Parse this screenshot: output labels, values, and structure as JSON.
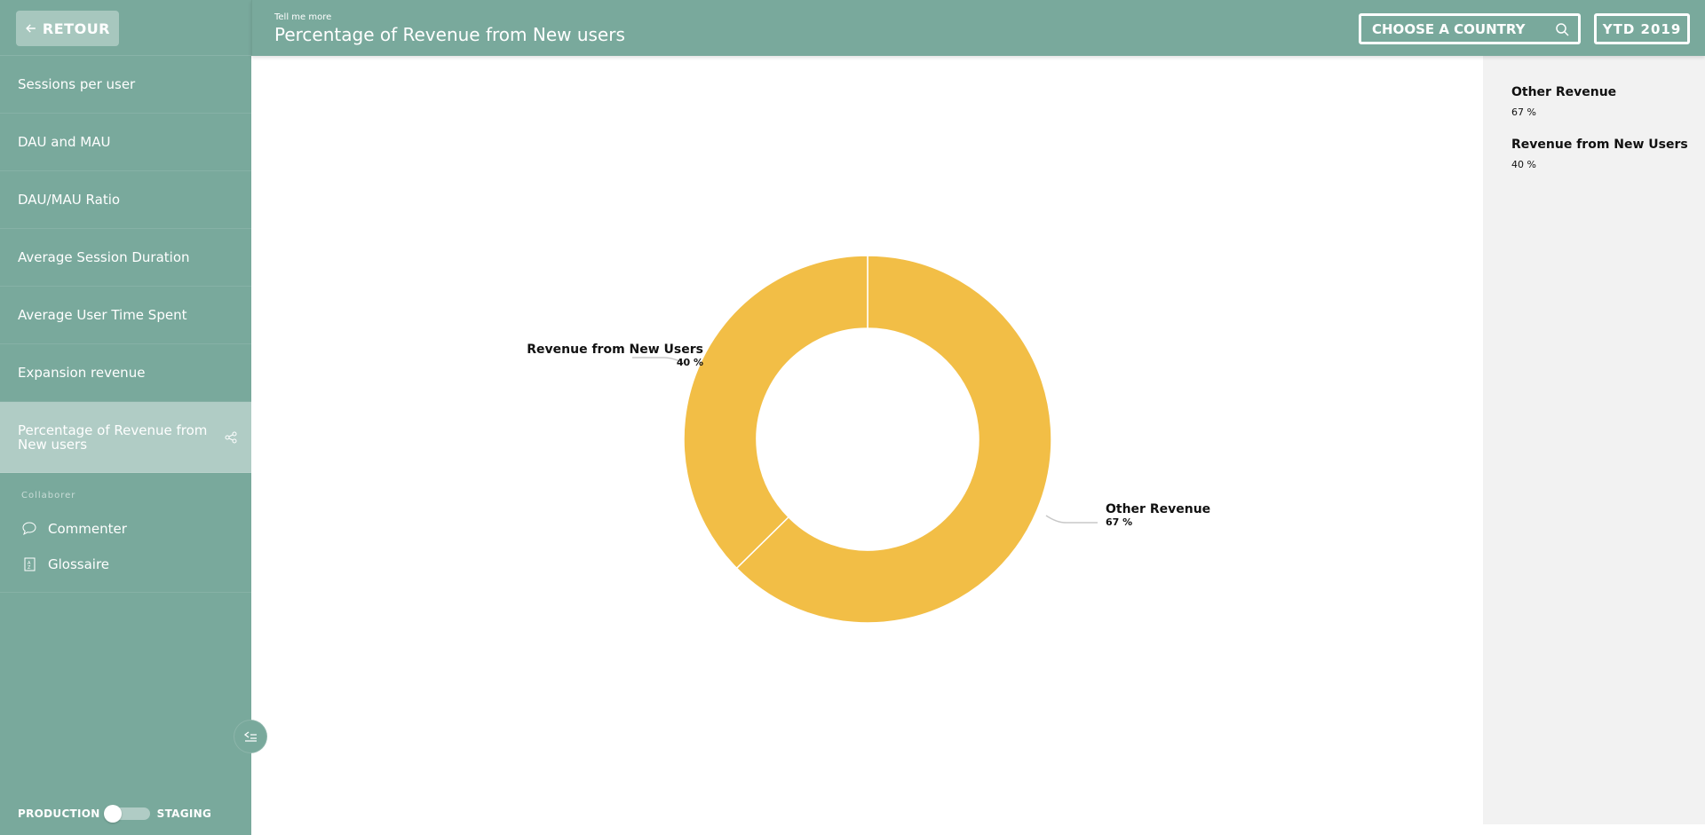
{
  "sidebar": {
    "back_label": "RETOUR",
    "items": [
      {
        "label": "Sessions per user"
      },
      {
        "label": "DAU and MAU"
      },
      {
        "label": "DAU/MAU Ratio"
      },
      {
        "label": "Average Session Duration"
      },
      {
        "label": "Average User Time Spent"
      },
      {
        "label": "Expansion revenue"
      },
      {
        "label": "Percentage of Revenue from New users",
        "active": true
      }
    ],
    "collab_title": "Collaborer",
    "collab_items": [
      {
        "label": "Commenter",
        "icon": "comment-icon"
      },
      {
        "label": "Glossaire",
        "icon": "glossary-icon"
      }
    ],
    "env_left": "PRODUCTION",
    "env_right": "STAGING",
    "env_selected": "PRODUCTION"
  },
  "header": {
    "subtitle": "Tell me more",
    "title": "Percentage of Revenue from New users",
    "country_placeholder": "CHOOSE A COUNTRY",
    "period": "YTD 2019"
  },
  "colors": {
    "brand": "#79a99c",
    "active_item": "#b0ccc5",
    "slice": "#f2be46",
    "panel": "#f2f2f2"
  },
  "chart_data": {
    "type": "pie",
    "donut": true,
    "title": "Percentage of Revenue from New users",
    "categories": [
      "Other Revenue",
      "Revenue from New Users"
    ],
    "values": [
      67,
      40
    ],
    "value_labels": [
      "67 %",
      "40 %"
    ],
    "legend": "right"
  }
}
